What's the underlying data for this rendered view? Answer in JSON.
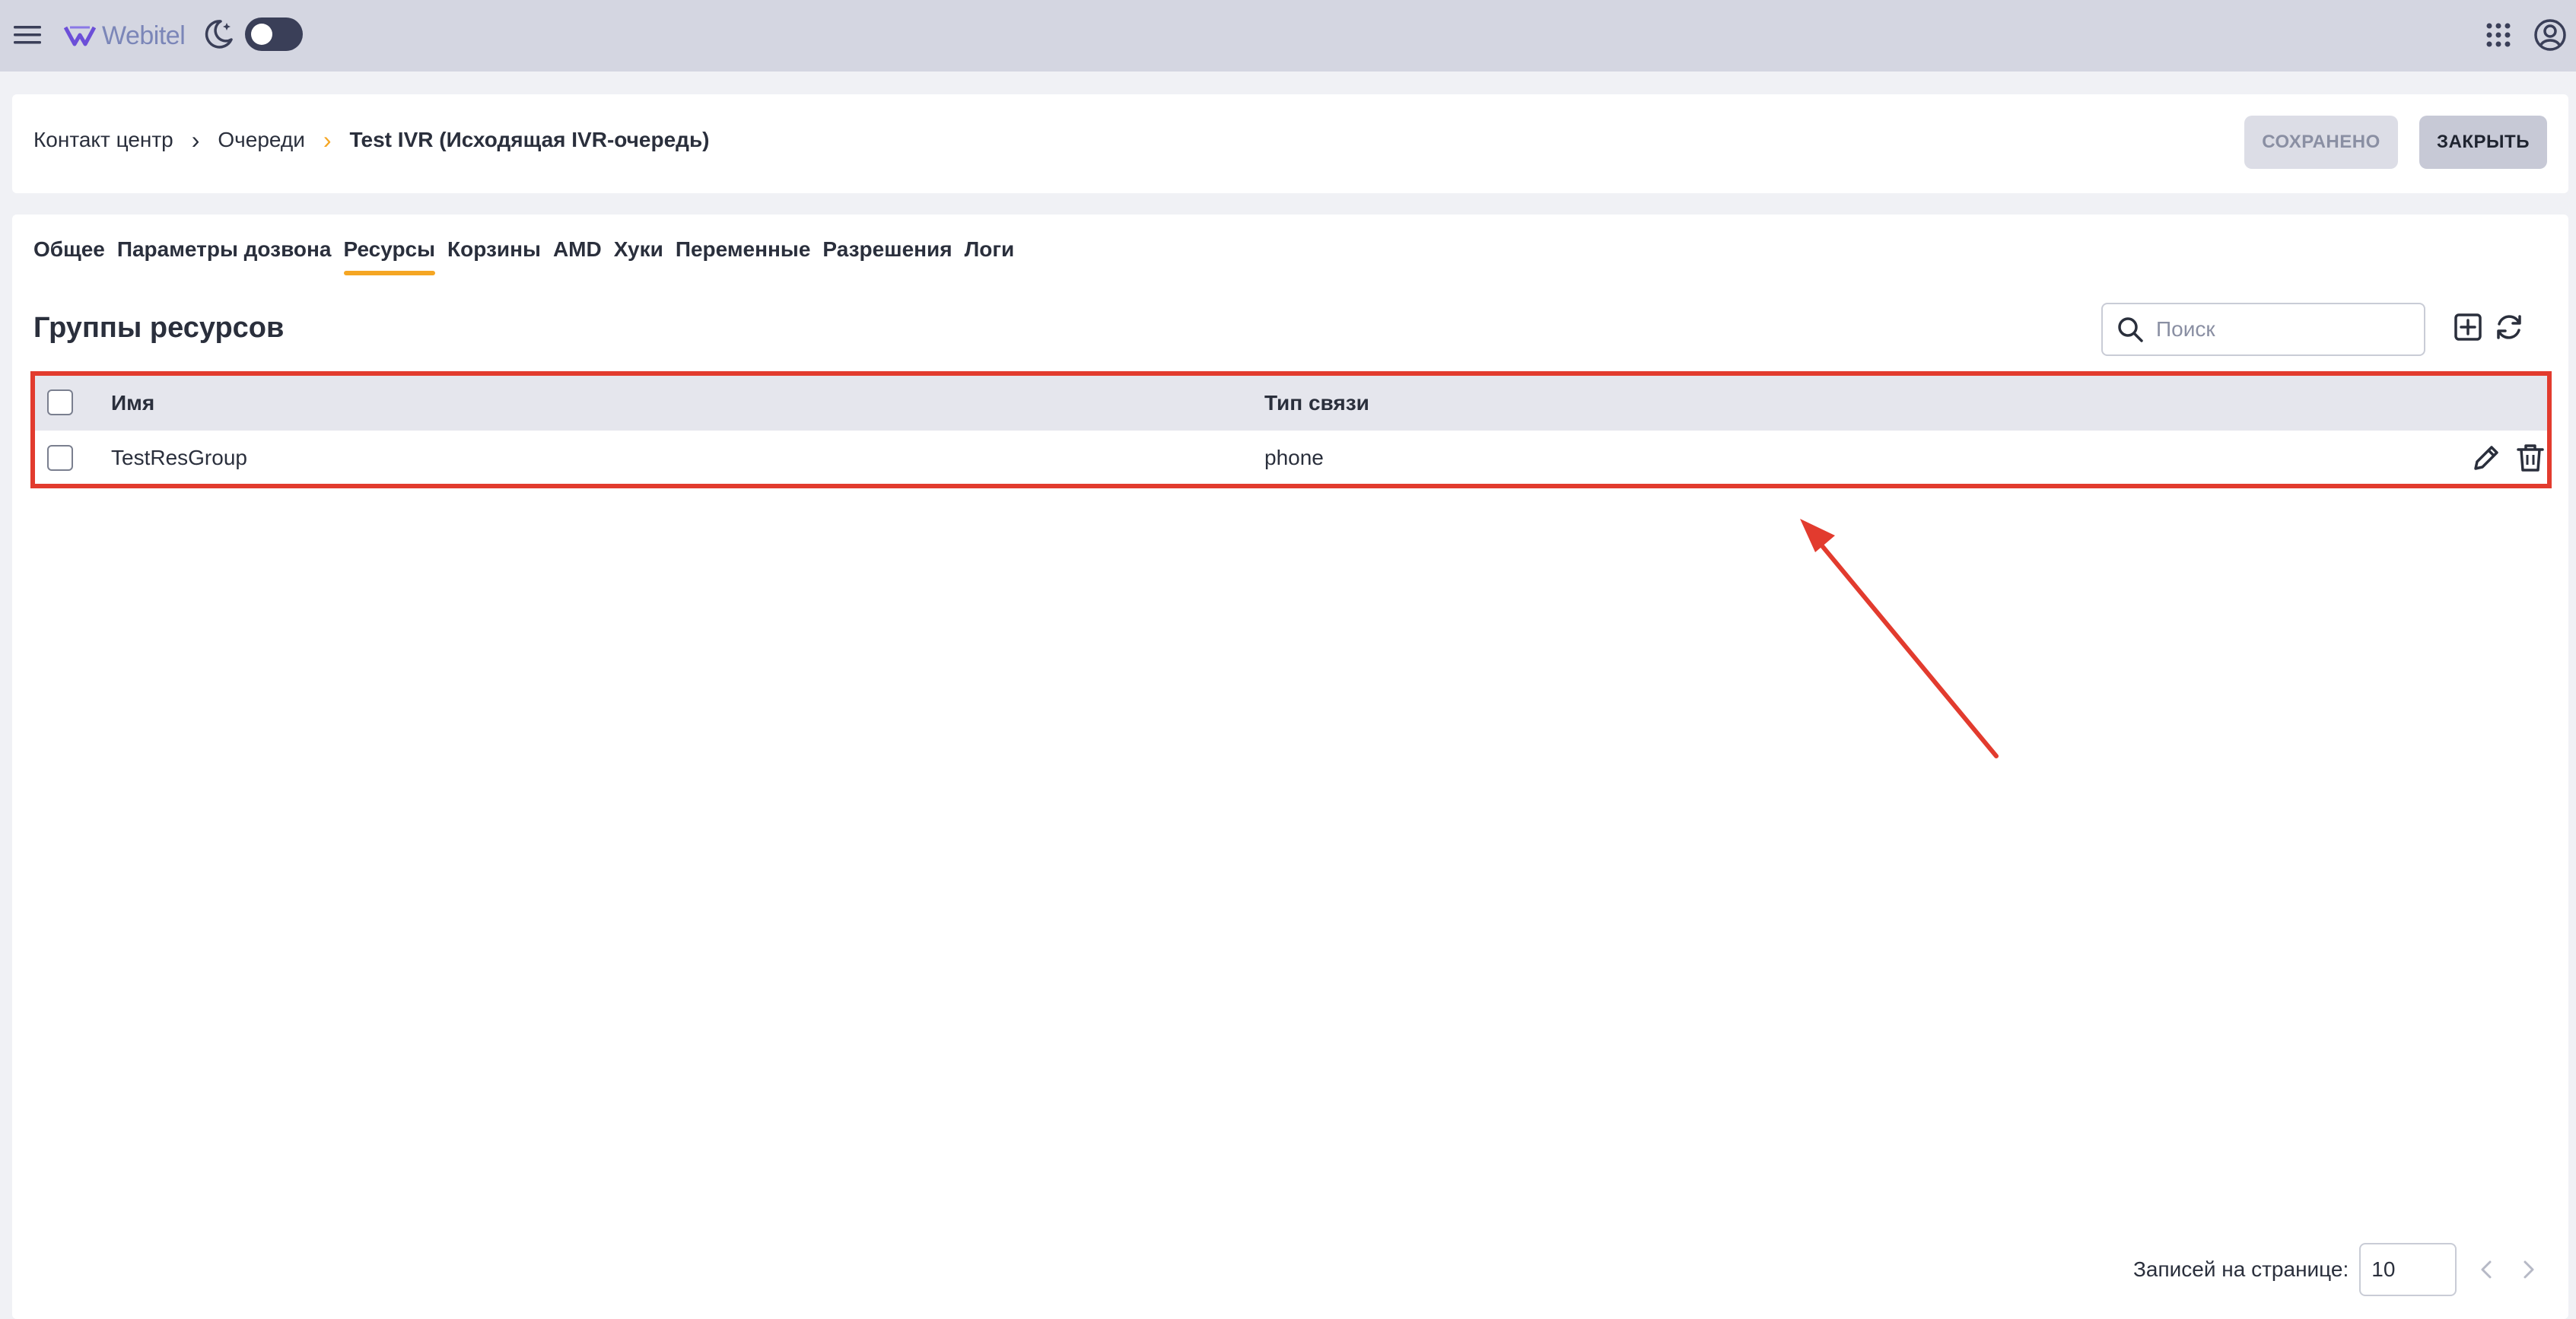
{
  "app": {
    "name": "Webitel"
  },
  "icons": {
    "menu": "hamburger-menu-icon",
    "theme": "moon-icon",
    "apps": "apps-grid-icon",
    "account": "account-icon",
    "search": "search-icon",
    "add": "add-icon",
    "refresh": "refresh-icon",
    "edit": "edit-icon",
    "delete": "delete-icon"
  },
  "breadcrumb": {
    "items": [
      "Контакт центр",
      "Очереди"
    ],
    "current": "Test IVR (Исходящая IVR-очередь)"
  },
  "header": {
    "saved_label": "СОХРАНЕНО",
    "close_label": "ЗАКРЫТЬ"
  },
  "tabs": [
    {
      "label": "Общее",
      "active": false
    },
    {
      "label": "Параметры дозвона",
      "active": false
    },
    {
      "label": "Ресурсы",
      "active": true
    },
    {
      "label": "Корзины",
      "active": false
    },
    {
      "label": "AMD",
      "active": false
    },
    {
      "label": "Хуки",
      "active": false
    },
    {
      "label": "Переменные",
      "active": false
    },
    {
      "label": "Разрешения",
      "active": false
    },
    {
      "label": "Логи",
      "active": false
    }
  ],
  "section": {
    "title": "Группы ресурсов",
    "search_placeholder": "Поиск"
  },
  "table": {
    "headers": {
      "name": "Имя",
      "type": "Тип связи"
    },
    "rows": [
      {
        "name": "TestResGroup",
        "type": "phone"
      }
    ]
  },
  "pager": {
    "label": "Записей на странице:",
    "per_page": "10"
  },
  "colors": {
    "accent": "#f5a623",
    "annotation": "#e23b2e",
    "topbar": "#d4d6e1"
  }
}
